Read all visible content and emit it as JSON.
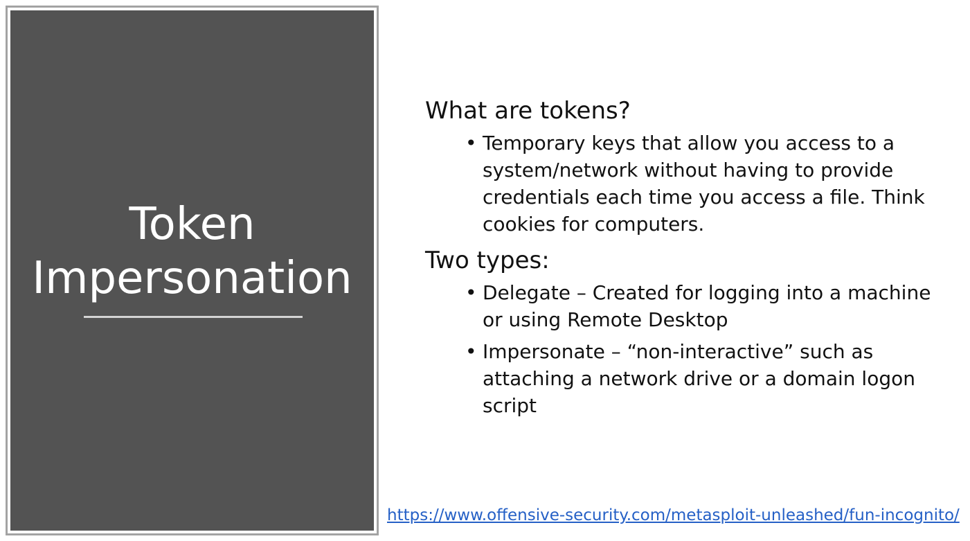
{
  "slide": {
    "title": "Token Impersonation",
    "sections": [
      {
        "heading": "What are tokens?",
        "bullets": [
          "Temporary keys that allow you access to a system/network without having to provide credentials each time you access a file. Think cookies for computers."
        ]
      },
      {
        "heading": "Two types:",
        "bullets": [
          "Delegate – Created for logging into a machine or using Remote Desktop",
          "Impersonate – “non-interactive” such as attaching a network drive or a domain logon script"
        ]
      }
    ],
    "bullet_glyph": "•",
    "link": "https://www.offensive-security.com/metasploit-unleashed/fun-incognito/"
  },
  "colors": {
    "panel_background": "#535353",
    "panel_border": "#a3a3a3",
    "title_text": "#ffffff",
    "body_text": "#111111",
    "link": "#2560c6"
  }
}
